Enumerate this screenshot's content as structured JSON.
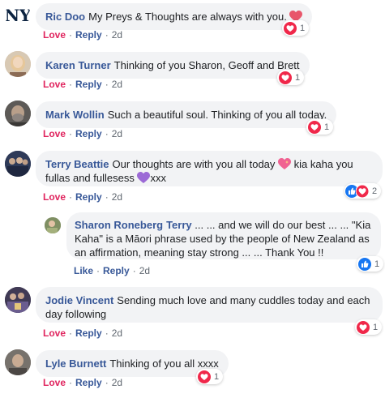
{
  "comments": [
    {
      "author": "Ric Doo",
      "text": "My Preys & Thoughts are always with you.",
      "action": "Love",
      "reply": "Reply",
      "time": "2d",
      "reaction_count": "1"
    },
    {
      "author": "Karen Turner",
      "text": "Thinking of you Sharon, Geoff and Brett",
      "action": "Love",
      "reply": "Reply",
      "time": "2d",
      "reaction_count": "1"
    },
    {
      "author": "Mark Wollin",
      "text": "Such a beautiful soul. Thinking of you all today.",
      "action": "Love",
      "reply": "Reply",
      "time": "2d",
      "reaction_count": "1"
    },
    {
      "author": "Terry Beattie",
      "text_part1": "Our thoughts are with you all today",
      "text_part2": "kia kaha you",
      "text_line2": "fullas and fullesess",
      "text_part3": "xxx",
      "action": "Love",
      "reply": "Reply",
      "time": "2d",
      "reaction_count": "2"
    },
    {
      "author": "Sharon Roneberg",
      "mention": "Terry",
      "line1": "... ... and we will do our best ... ... \"Kia",
      "line2": "Kaha\" is a Māori phrase used by the people of New Zealand as",
      "line3": "an affirmation, meaning stay strong ... ... Thank You !!",
      "action": "Like",
      "reply": "Reply",
      "time": "2d",
      "reaction_count": "1"
    },
    {
      "author": "Jodie Vincent",
      "line1": "Sending much love and many cuddles today and each",
      "line2": "day following",
      "action": "Love",
      "reply": "Reply",
      "time": "2d",
      "reaction_count": "1"
    },
    {
      "author": "Lyle Burnett",
      "text": "Thinking of you all xxxx",
      "action": "Love",
      "reply": "Reply",
      "time": "2d",
      "reaction_count": "1"
    }
  ],
  "colors": {
    "link": "#385898",
    "love": "#e0245e",
    "bubble": "#f2f3f5",
    "meta": "#606770"
  },
  "icons": [
    "ny-yankees-logo-avatar",
    "heart-reaction-icon",
    "like-reaction-icon",
    "sparkling-heart-emoji",
    "purple-heart-emoji"
  ]
}
